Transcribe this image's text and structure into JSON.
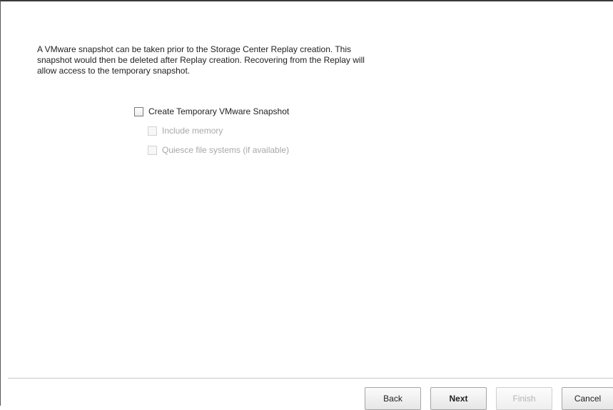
{
  "description": {
    "line1": "A VMware snapshot can be taken prior to the Storage Center Replay creation. This",
    "line2": "snapshot would then be deleted after Replay creation. Recovering from the Replay will",
    "line3": "allow access to the temporary snapshot."
  },
  "options": {
    "create_snapshot": {
      "label": "Create Temporary VMware Snapshot",
      "checked": false,
      "enabled": true
    },
    "include_memory": {
      "label": "Include memory",
      "checked": false,
      "enabled": false
    },
    "quiesce": {
      "label": "Quiesce file systems (if available)",
      "checked": false,
      "enabled": false
    }
  },
  "buttons": {
    "back": "Back",
    "next": "Next",
    "finish": "Finish",
    "cancel": "Cancel"
  }
}
